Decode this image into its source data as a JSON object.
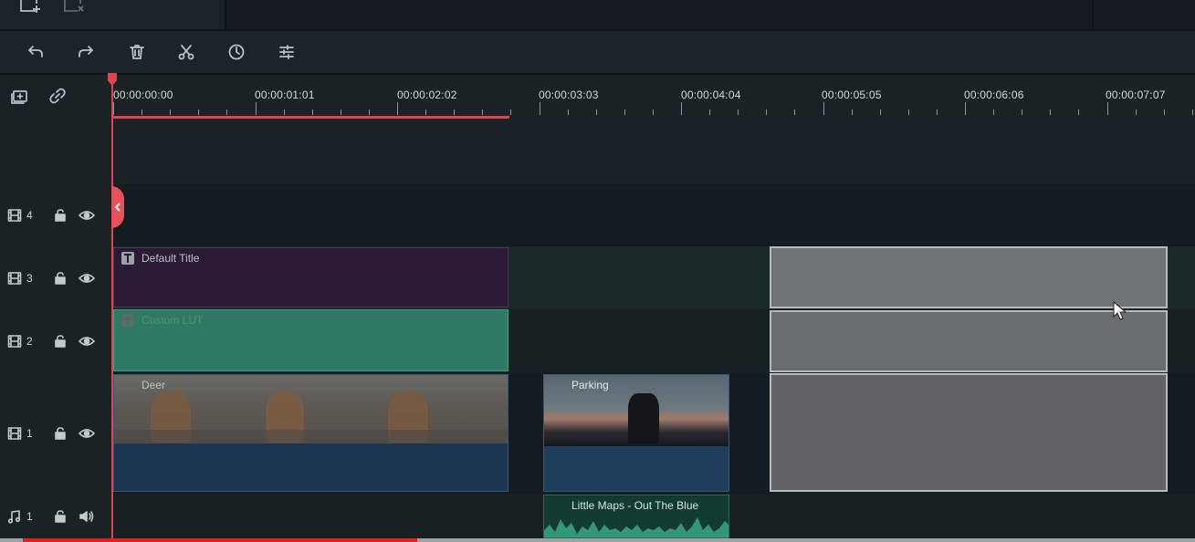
{
  "toolbar": {
    "buttons": [
      "undo-icon",
      "redo-icon",
      "delete-icon",
      "cut-icon",
      "speed-icon",
      "adjust-icon"
    ]
  },
  "ruler": {
    "timecodes": [
      "00:00:00:00",
      "00:00:01:01",
      "00:00:02:02",
      "00:00:03:03",
      "00:00:04:04",
      "00:00:05:05",
      "00:00:06:06",
      "00:00:07:07"
    ]
  },
  "tracks": [
    {
      "id": "video-4",
      "type": "video",
      "number": "4"
    },
    {
      "id": "video-3",
      "type": "video",
      "number": "3"
    },
    {
      "id": "video-2",
      "type": "video",
      "number": "2"
    },
    {
      "id": "video-1",
      "type": "video",
      "number": "1"
    },
    {
      "id": "audio-1",
      "type": "audio",
      "number": "1"
    }
  ],
  "clips": {
    "title": "Default Title",
    "lut": "Custom LUT",
    "deer": "Deer",
    "parking": "Parking",
    "audio": "Little Maps - Out The Blue"
  },
  "colors": {
    "playhead": "#e0454f",
    "title_clip": "#2b1a36",
    "lut_clip": "#2f7a64",
    "video_clip_bottom": "#1c3550",
    "selected_clip": "#6f7275",
    "progress": "#e21f1f"
  },
  "progress": {
    "played_fraction": 0.33
  }
}
